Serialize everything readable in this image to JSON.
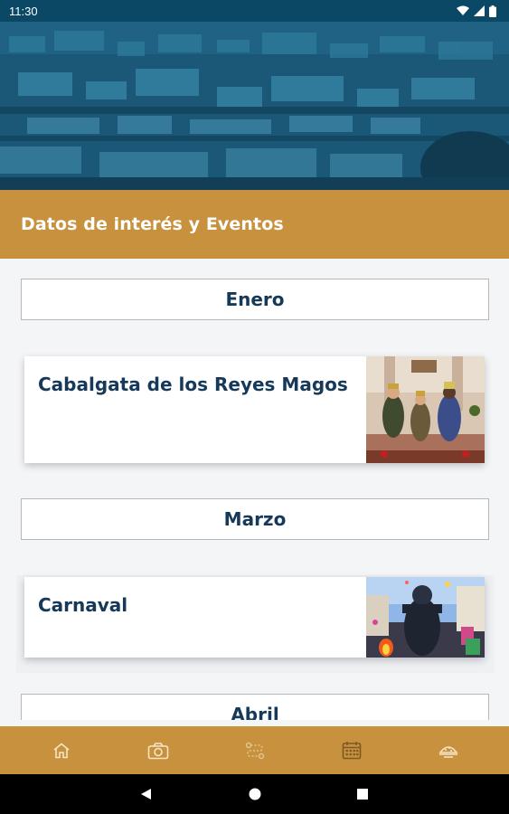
{
  "status_bar": {
    "time": "11:30"
  },
  "header": {
    "title": "Datos de interés y Eventos"
  },
  "months": [
    {
      "label": "Enero"
    },
    {
      "label": "Marzo"
    },
    {
      "label": "Abril"
    }
  ],
  "events": [
    {
      "title": "Cabalgata de los Reyes Magos"
    },
    {
      "title": "Carnaval"
    }
  ],
  "bottom_nav": {
    "items": [
      {
        "icon": "home-icon"
      },
      {
        "icon": "camera-icon"
      },
      {
        "icon": "route-icon"
      },
      {
        "icon": "calendar-icon",
        "active": true
      },
      {
        "icon": "food-icon"
      }
    ]
  },
  "colors": {
    "accent": "#c8913e",
    "title_blue": "#16395a",
    "status_bar": "#0b4866"
  }
}
